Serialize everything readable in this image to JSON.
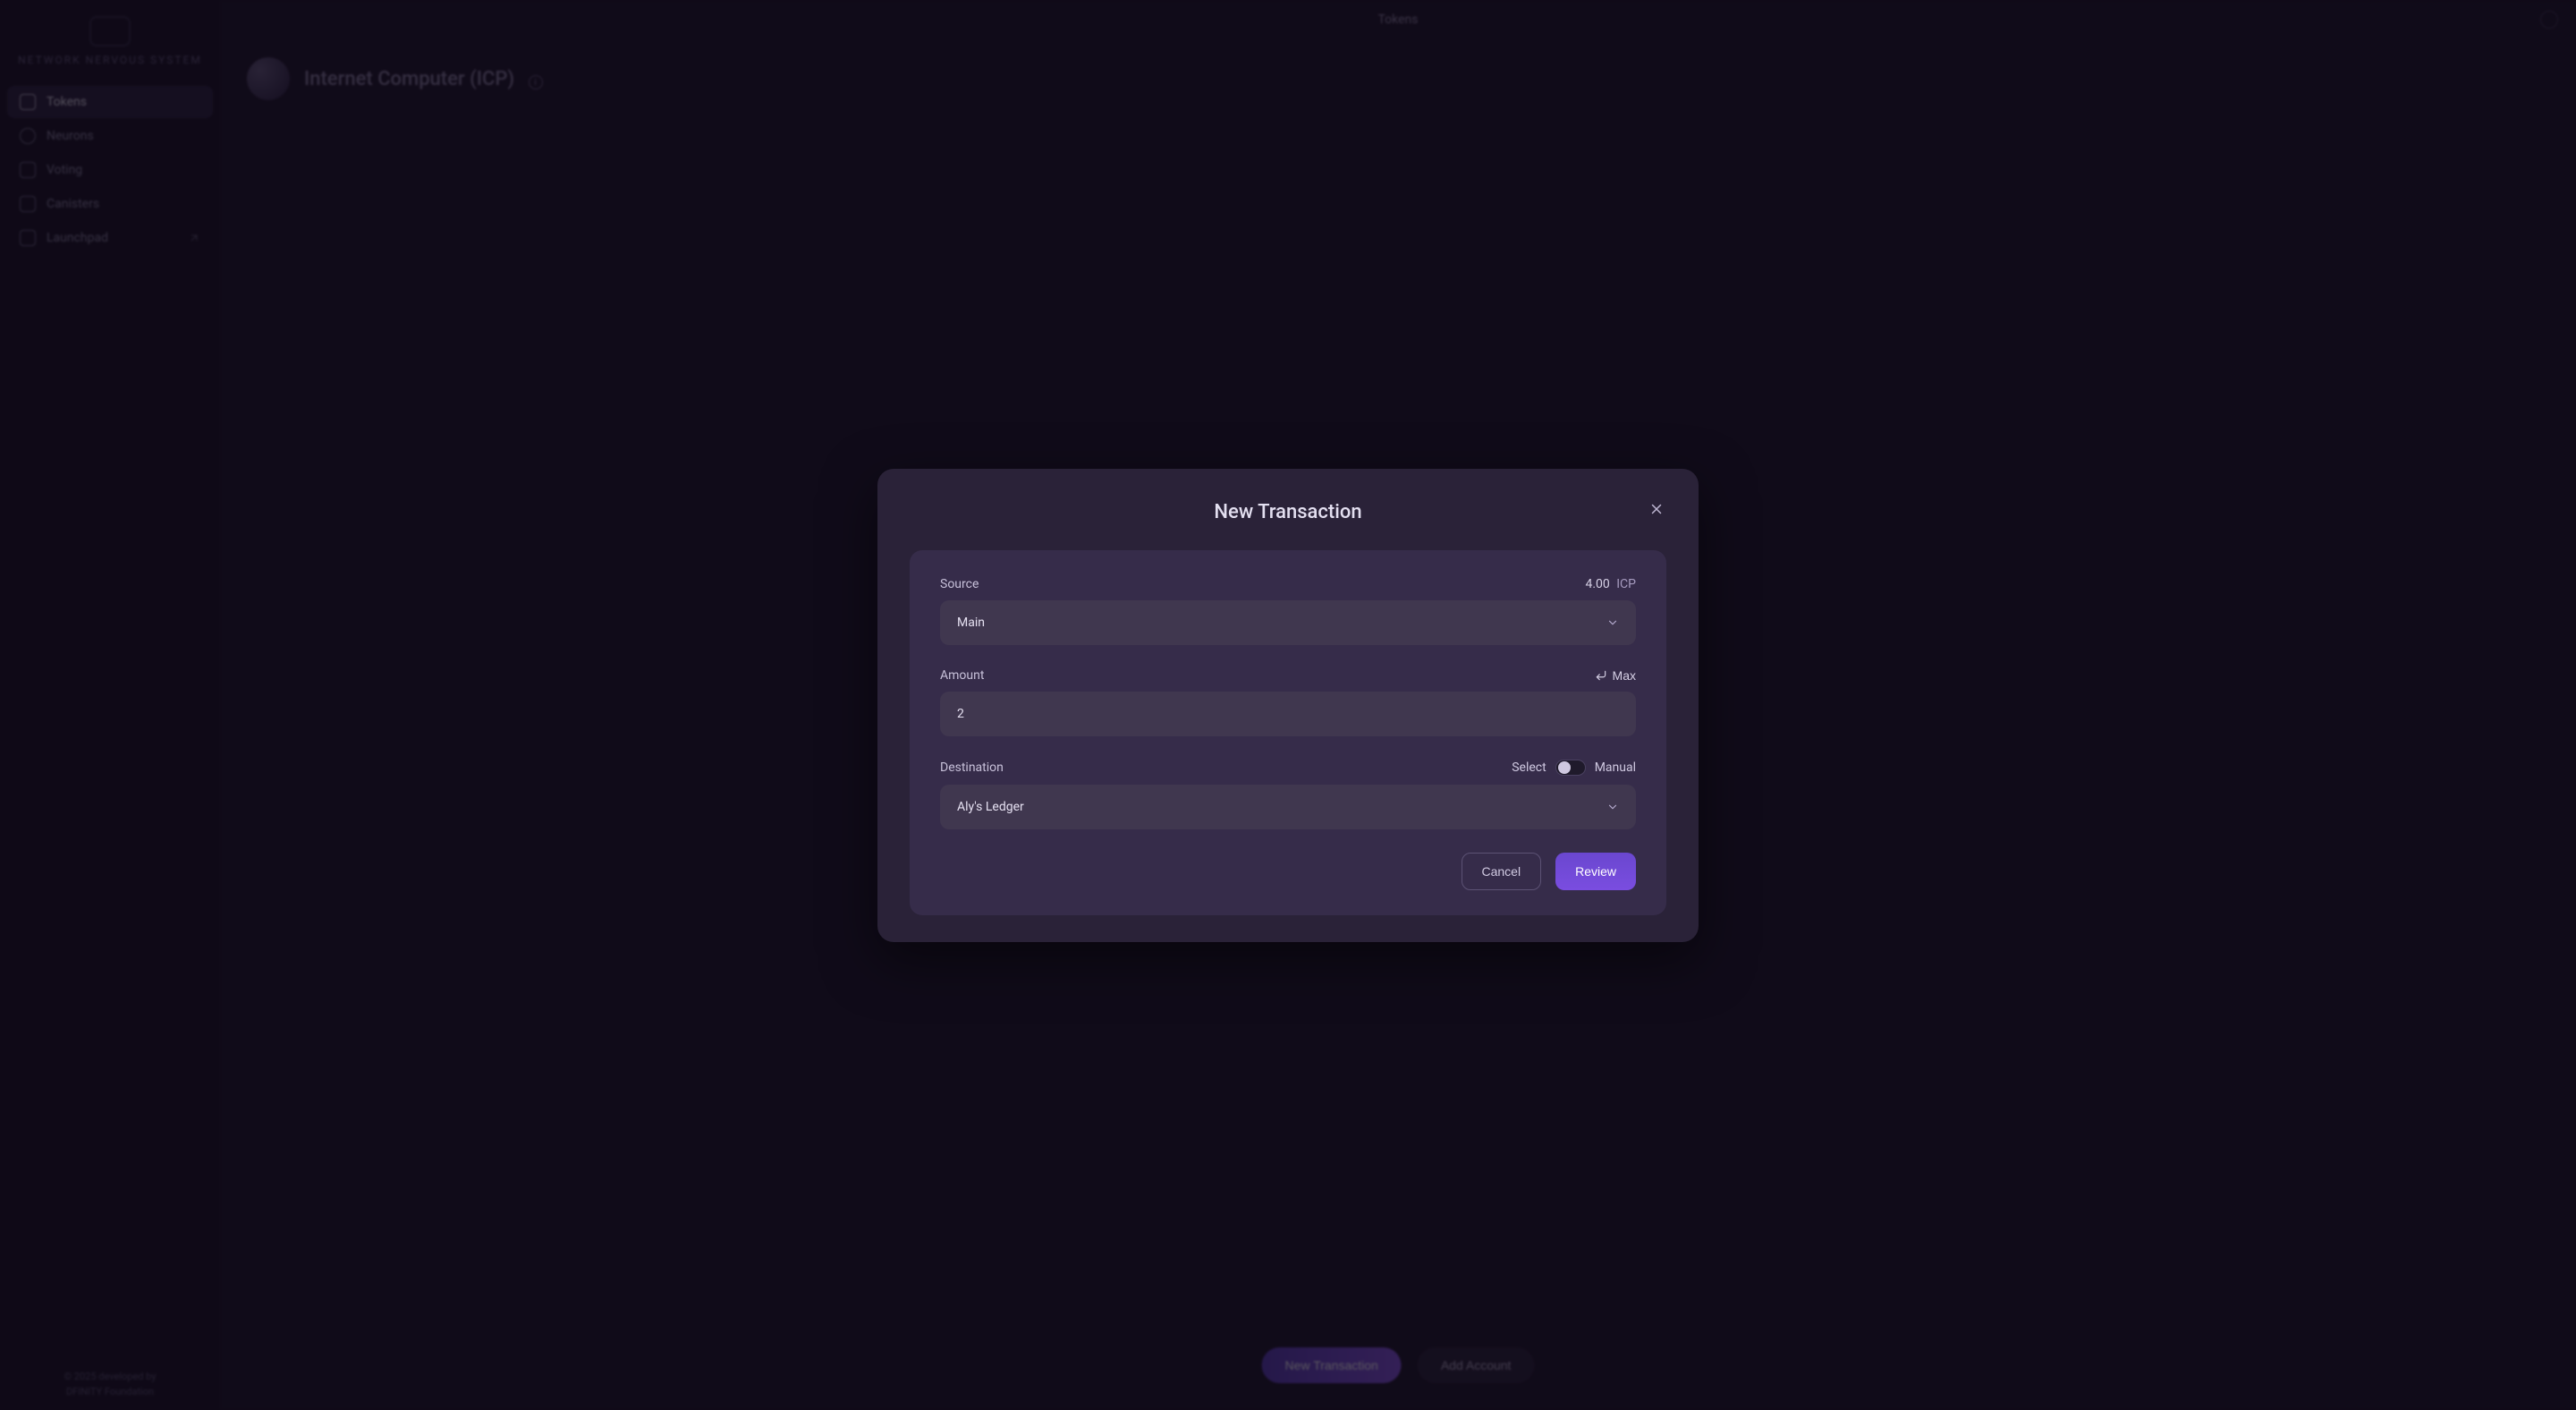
{
  "app": {
    "logo_text": "NETWORK NERVOUS SYSTEM",
    "page_title": "Tokens",
    "token_heading": "Internet Computer (ICP)",
    "footer_lines": [
      "© 2025 developed by",
      "DFINITY Foundation"
    ]
  },
  "sidebar": {
    "items": [
      {
        "label": "Tokens"
      },
      {
        "label": "Neurons"
      },
      {
        "label": "Voting"
      },
      {
        "label": "Canisters"
      },
      {
        "label": "Launchpad"
      }
    ]
  },
  "bottom_actions": {
    "primary": "New Transaction",
    "secondary": "Add Account"
  },
  "modal": {
    "title": "New Transaction",
    "source": {
      "label": "Source",
      "balance_value": "4.00",
      "balance_unit": "ICP",
      "selected": "Main"
    },
    "amount": {
      "label": "Amount",
      "max_label": "Max",
      "value": "2"
    },
    "destination": {
      "label": "Destination",
      "mode_left": "Select",
      "mode_right": "Manual",
      "selected": "Aly's Ledger"
    },
    "actions": {
      "cancel": "Cancel",
      "review": "Review"
    }
  }
}
